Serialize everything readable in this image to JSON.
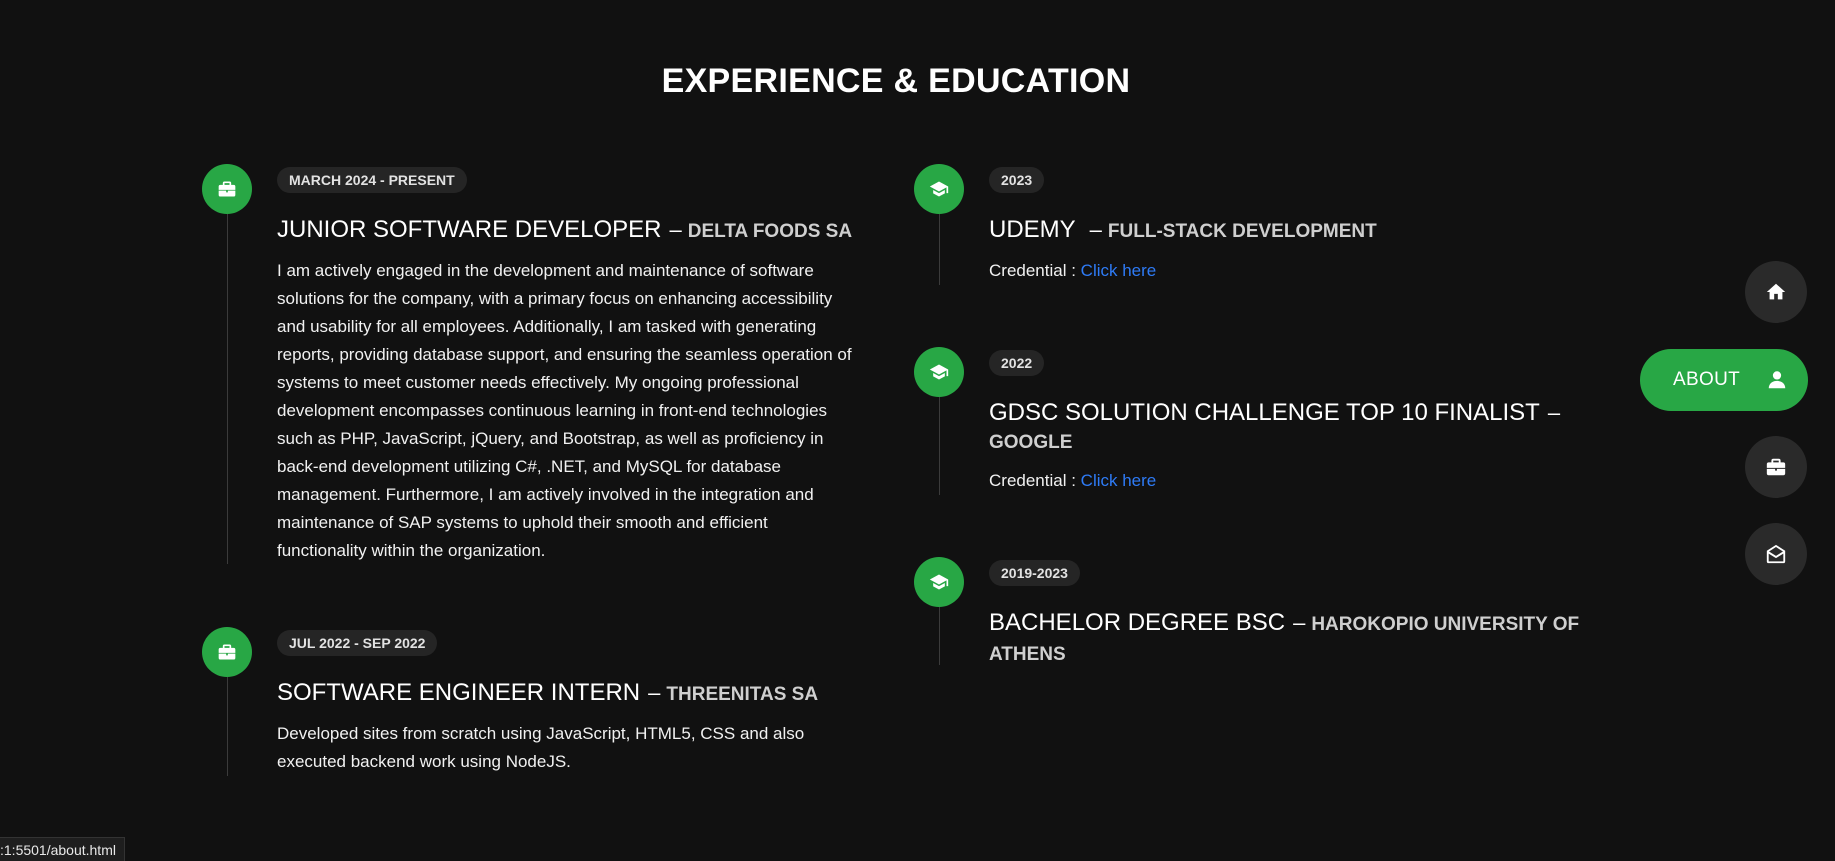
{
  "section": {
    "title": "EXPERIENCE & EDUCATION"
  },
  "experience": [
    {
      "date": "MARCH 2024 - PRESENT",
      "role": "JUNIOR SOFTWARE DEVELOPER",
      "separator": "–",
      "company": "DELTA FOODS SA",
      "icon": "briefcase-icon",
      "description": "I am actively engaged in the development and maintenance of software solutions for the company, with a primary focus on enhancing accessibility and usability for all employees. Additionally, I am tasked with generating reports, providing database support, and ensuring the seamless operation of systems to meet customer needs effectively. My ongoing professional development encompasses continuous learning in front-end technologies such as PHP, JavaScript, jQuery, and Bootstrap, as well as proficiency in back-end development utilizing C#, .NET, and MySQL for database management. Furthermore, I am actively involved in the integration and maintenance of SAP systems to uphold their smooth and efficient functionality within the organization."
    },
    {
      "date": "JUL 2022 - SEP 2022",
      "role": "SOFTWARE ENGINEER INTERN",
      "separator": "–",
      "company": "THREENITAS SA",
      "icon": "briefcase-icon",
      "description": "Developed sites from scratch using JavaScript, HTML5, CSS and also executed backend work using NodeJS."
    }
  ],
  "education": [
    {
      "date": "2023",
      "title": "UDEMY",
      "separator": "–",
      "org": "FULL-STACK DEVELOPMENT",
      "icon": "graduation-cap-icon",
      "credential_label": "Credential : ",
      "credential_link": "Click here"
    },
    {
      "date": "2022",
      "title": "GDSC SOLUTION CHALLENGE TOP 10 FINALIST",
      "separator": "–",
      "org": "GOOGLE",
      "icon": "graduation-cap-icon",
      "credential_label": "Credential : ",
      "credential_link": "Click here"
    },
    {
      "date": "2019-2023",
      "title": "BACHELOR DEGREE BSC",
      "separator": "–",
      "org": "HAROKOPIO UNIVERSITY OF ATHENS",
      "icon": "graduation-cap-icon"
    }
  ],
  "side_nav": {
    "items": [
      {
        "icon": "home-icon",
        "label": ""
      },
      {
        "icon": "user-icon",
        "label": "ABOUT",
        "active": true
      },
      {
        "icon": "briefcase-icon",
        "label": ""
      },
      {
        "icon": "envelope-open-icon",
        "label": ""
      }
    ]
  },
  "status_bar": {
    "url": ":1:5501/about.html"
  },
  "colors": {
    "background": "#111111",
    "accent": "#28a745",
    "link": "#2e7bf6",
    "badge_bg": "#252525"
  }
}
